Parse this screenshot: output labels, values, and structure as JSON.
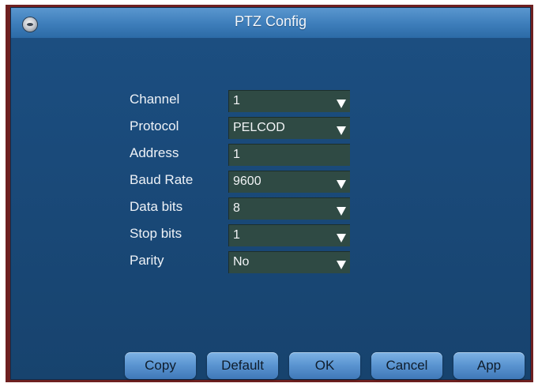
{
  "window": {
    "title": "PTZ Config"
  },
  "form": {
    "fields": [
      {
        "label": "Channel",
        "value": "1",
        "dropdown": true
      },
      {
        "label": "Protocol",
        "value": "PELCOD",
        "dropdown": true
      },
      {
        "label": "Address",
        "value": "1",
        "dropdown": false
      },
      {
        "label": "Baud Rate",
        "value": "9600",
        "dropdown": true
      },
      {
        "label": "Data bits",
        "value": "8",
        "dropdown": true
      },
      {
        "label": "Stop bits",
        "value": "1",
        "dropdown": true
      },
      {
        "label": "Parity",
        "value": "No",
        "dropdown": true
      }
    ]
  },
  "buttons": {
    "copy": "Copy",
    "default": "Default",
    "ok": "OK",
    "cancel": "Cancel",
    "apply": "App"
  },
  "colors": {
    "window_bg": "#1a4a7a",
    "titlebar": "#3f7fbc",
    "field_bg": "#2f4a44",
    "button": "#5c96d2",
    "text": "#eef2f7"
  }
}
